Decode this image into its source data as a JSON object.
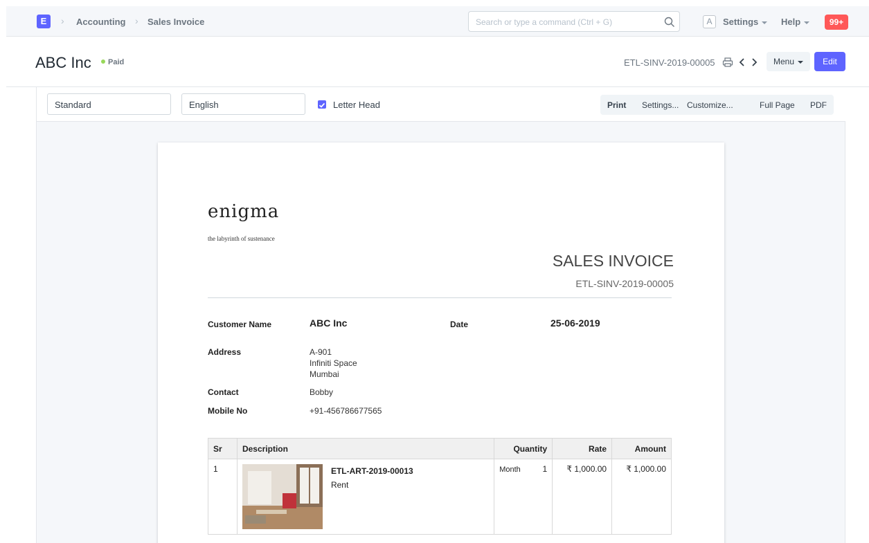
{
  "navbar": {
    "logo_letter": "E",
    "breadcrumbs": [
      "Accounting",
      "Sales Invoice"
    ],
    "search_placeholder": "Search or type a command (Ctrl + G)",
    "avatar_letter": "A",
    "settings_label": "Settings",
    "help_label": "Help",
    "notifications_badge": "99+"
  },
  "page_head": {
    "title": "ABC Inc",
    "status": "Paid",
    "doc_id": "ETL-SINV-2019-00005",
    "menu_label": "Menu",
    "edit_label": "Edit"
  },
  "print_toolbar": {
    "print_format": "Standard",
    "language": "English",
    "letter_head_label": "Letter Head",
    "letter_head_checked": true,
    "buttons": [
      "Print",
      "Settings...",
      "Customize...",
      "Full Page",
      "PDF"
    ]
  },
  "invoice": {
    "brand_name": "enigma",
    "tagline": "the labyrinth of sustenance",
    "title": "SALES INVOICE",
    "number": "ETL-SINV-2019-00005",
    "customer_name_label": "Customer Name",
    "customer_name": "ABC Inc",
    "date_label": "Date",
    "date": "25-06-2019",
    "address_label": "Address",
    "address_lines": [
      "A-901",
      "Infiniti Space",
      "Mumbai"
    ],
    "contact_label": "Contact",
    "contact": "Bobby",
    "mobile_label": "Mobile No",
    "mobile": "+91-456786677565",
    "table_headers": [
      "Sr",
      "Description",
      "Quantity",
      "Rate",
      "Amount"
    ],
    "items": [
      {
        "sr": "1",
        "item_code": "ETL-ART-2019-00013",
        "item_name": "Rent",
        "uom": "Month",
        "qty": "1",
        "rate": "₹ 1,000.00",
        "amount": "₹ 1,000.00"
      }
    ]
  },
  "colors": {
    "primary": "#5e64ff",
    "badge": "#ff5858",
    "paid_indicator": "#98d85b"
  }
}
